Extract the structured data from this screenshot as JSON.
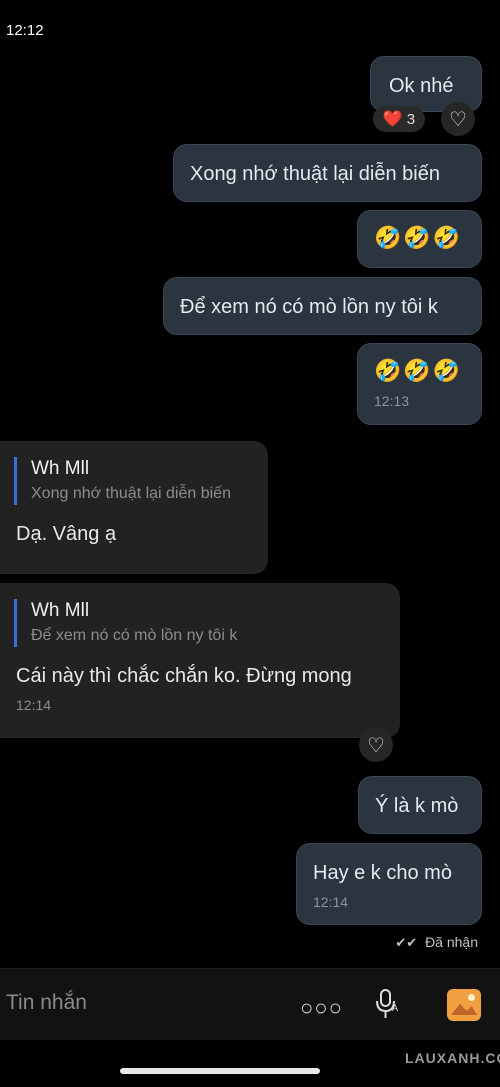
{
  "status_time": "12:12",
  "messages": {
    "m1": {
      "text": "Ok nhé"
    },
    "reaction": {
      "emoji": "❤️",
      "count": "3"
    },
    "m2": {
      "text": "Xong nhớ thuật lại diễn biến"
    },
    "m3": {
      "text": "🤣🤣🤣"
    },
    "m4": {
      "text": "Để xem nó có mò lồn ny tôi k"
    },
    "m5": {
      "text": "🤣🤣🤣",
      "time": "12:13"
    },
    "m6": {
      "reply_name": "Wh Mll",
      "reply_text": "Xong nhớ thuật lại diễn biến",
      "text": "Dạ. Vâng ạ"
    },
    "m7": {
      "reply_name": "Wh Mll",
      "reply_text": "Để xem nó có mò lồn ny tôi k",
      "text": "Cái này thì chắc chắn ko. Đừng mong",
      "time": "12:14"
    },
    "m8": {
      "text": "Ý là k mò"
    },
    "m9": {
      "text": "Hay e k cho mò",
      "time": "12:14"
    }
  },
  "delivery_status": "Đã nhận",
  "input": {
    "placeholder": "Tin nhắn"
  },
  "watermark": "LAUXANH.CC",
  "icons": [
    "heart-icon",
    "more-icon",
    "mic-icon",
    "image-icon",
    "check-icon"
  ]
}
